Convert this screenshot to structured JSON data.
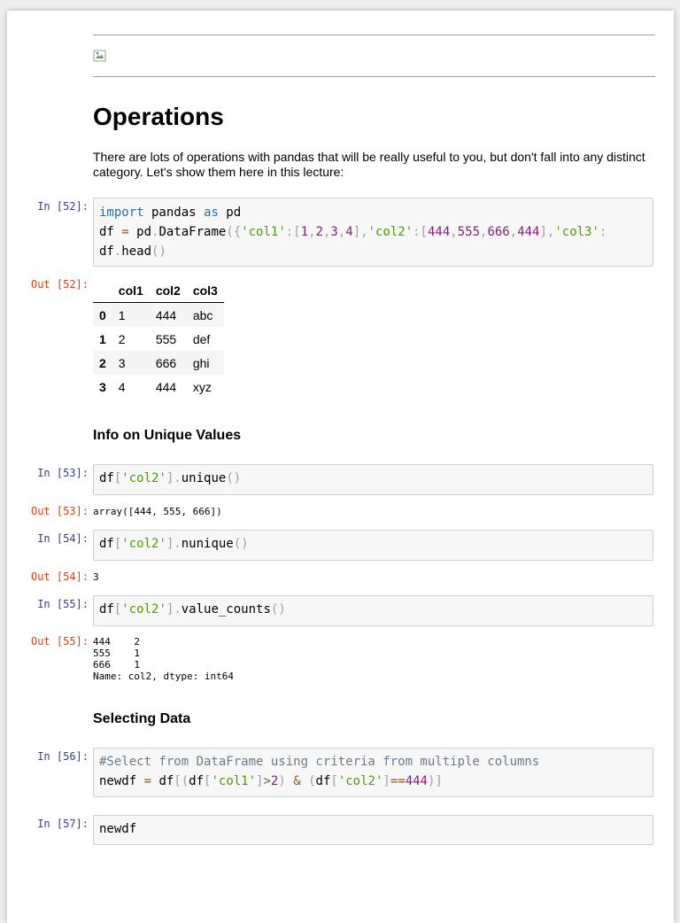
{
  "notebook": {
    "title": "Operations",
    "intro": "There are lots of operations with pandas that will be really useful to you, but don't fall into any distinct category. Let's show them here in this lecture:",
    "section_unique": "Info on Unique Values",
    "section_select": "Selecting Data"
  },
  "cells": {
    "c52": {
      "in_prompt": "In [52]:",
      "out_prompt": "Out [52]:",
      "line1": [
        "import",
        " pandas ",
        "as",
        " pd"
      ],
      "line2": [
        "df ",
        "=",
        " pd",
        ".",
        "DataFrame",
        "({",
        "'col1'",
        ":[",
        "1",
        ",",
        "2",
        ",",
        "3",
        ",",
        "4",
        "],",
        "'col2'",
        ":[",
        "444",
        ",",
        "555",
        ",",
        "666",
        ",",
        "444",
        "],",
        "'col3'",
        ":"
      ],
      "line3": [
        "df",
        ".",
        "head",
        "()"
      ]
    },
    "c53": {
      "in_prompt": "In [53]:",
      "out_prompt": "Out [53]:",
      "code": [
        "df",
        "[",
        "'col2'",
        "].",
        "unique",
        "()"
      ],
      "output": "array([444, 555, 666])"
    },
    "c54": {
      "in_prompt": "In [54]:",
      "out_prompt": "Out [54]:",
      "code": [
        "df",
        "[",
        "'col2'",
        "].",
        "nunique",
        "()"
      ],
      "output": "3"
    },
    "c55": {
      "in_prompt": "In [55]:",
      "out_prompt": "Out [55]:",
      "code": [
        "df",
        "[",
        "'col2'",
        "].",
        "value_counts",
        "()"
      ],
      "output": "444    2\n555    1\n666    1\nName: col2, dtype: int64"
    },
    "c56": {
      "in_prompt": "In [56]:",
      "comment": "#Select from DataFrame using criteria from multiple columns",
      "line2": [
        "newdf ",
        "=",
        " df",
        "[(",
        "df",
        "[",
        "'col1'",
        "]",
        ">",
        "2",
        ") ",
        "&",
        " (",
        "df",
        "[",
        "'col2'",
        "]",
        "==",
        "444",
        ")]"
      ]
    },
    "c57": {
      "in_prompt": "In [57]:",
      "code": "newdf"
    }
  },
  "dataframe": {
    "columns": [
      "",
      "col1",
      "col2",
      "col3"
    ],
    "rows": [
      [
        "0",
        "1",
        "444",
        "abc"
      ],
      [
        "1",
        "2",
        "555",
        "def"
      ],
      [
        "2",
        "3",
        "666",
        "ghi"
      ],
      [
        "3",
        "4",
        "444",
        "xyz"
      ]
    ]
  }
}
